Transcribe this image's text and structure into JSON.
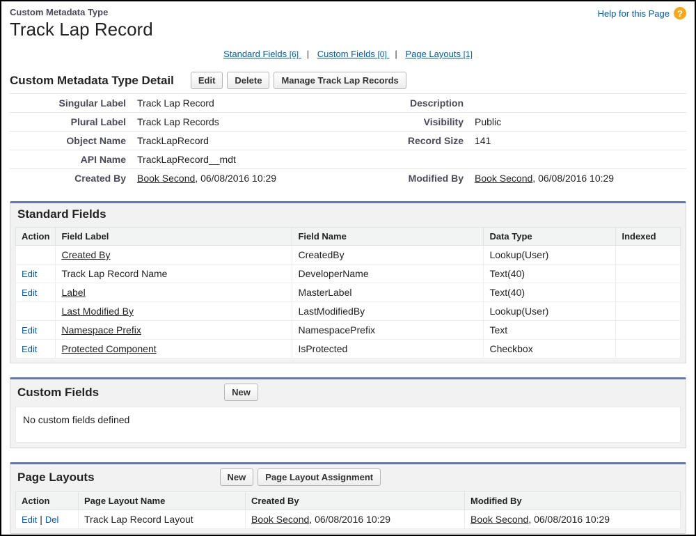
{
  "header": {
    "subtitle": "Custom Metadata Type",
    "title": "Track Lap Record",
    "help_label": "Help for this Page"
  },
  "anchors": {
    "standard": {
      "label": "Standard Fields",
      "count": "[6]"
    },
    "custom": {
      "label": "Custom Fields",
      "count": "[0]"
    },
    "layouts": {
      "label": "Page Layouts",
      "count": "[1]"
    }
  },
  "detail": {
    "heading": "Custom Metadata Type Detail",
    "buttons": {
      "edit": "Edit",
      "delete": "Delete",
      "manage": "Manage Track Lap Records"
    },
    "rows": [
      {
        "l1": "Singular Label",
        "v1": "Track Lap Record",
        "l2": "Description",
        "v2": ""
      },
      {
        "l1": "Plural Label",
        "v1": "Track Lap Records",
        "l2": "Visibility",
        "v2": "Public"
      },
      {
        "l1": "Object Name",
        "v1": "TrackLapRecord",
        "l2": "Record Size",
        "v2": "141"
      },
      {
        "l1": "API Name",
        "v1": "TrackLapRecord__mdt",
        "l2": "",
        "v2": ""
      }
    ],
    "created_by_label": "Created By",
    "created_by_link": "Book Second",
    "created_by_rest": ", 06/08/2016 10:29",
    "modified_by_label": "Modified By",
    "modified_by_link": "Book Second",
    "modified_by_rest": ", 06/08/2016 10:29"
  },
  "standard_fields": {
    "heading": "Standard Fields",
    "cols": {
      "action": "Action",
      "label": "Field Label",
      "name": "Field Name",
      "type": "Data Type",
      "indexed": "Indexed"
    },
    "rows": [
      {
        "action": "",
        "label": "Created By",
        "link": true,
        "name": "CreatedBy",
        "type": "Lookup(User)",
        "indexed": ""
      },
      {
        "action": "Edit",
        "label": "Track Lap Record Name",
        "link": false,
        "name": "DeveloperName",
        "type": "Text(40)",
        "indexed": ""
      },
      {
        "action": "Edit",
        "label": "Label",
        "link": true,
        "name": "MasterLabel",
        "type": "Text(40)",
        "indexed": ""
      },
      {
        "action": "",
        "label": "Last Modified By",
        "link": true,
        "name": "LastModifiedBy",
        "type": "Lookup(User)",
        "indexed": ""
      },
      {
        "action": "Edit",
        "label": "Namespace Prefix",
        "link": true,
        "name": "NamespacePrefix",
        "type": "Text",
        "indexed": ""
      },
      {
        "action": "Edit",
        "label": "Protected Component",
        "link": true,
        "name": "IsProtected",
        "type": "Checkbox",
        "indexed": ""
      }
    ]
  },
  "custom_fields": {
    "heading": "Custom Fields",
    "new_btn": "New",
    "empty": "No custom fields defined"
  },
  "page_layouts": {
    "heading": "Page Layouts",
    "new_btn": "New",
    "assign_btn": "Page Layout Assignment",
    "cols": {
      "action": "Action",
      "name": "Page Layout Name",
      "created": "Created By",
      "modified": "Modified By"
    },
    "row": {
      "edit": "Edit",
      "sep": " | ",
      "del": "Del",
      "name": "Track Lap Record Layout",
      "cb_link": "Book Second",
      "cb_rest": ", 06/08/2016 10:29",
      "mb_link": "Book Second",
      "mb_rest": ", 06/08/2016 10:29"
    }
  }
}
